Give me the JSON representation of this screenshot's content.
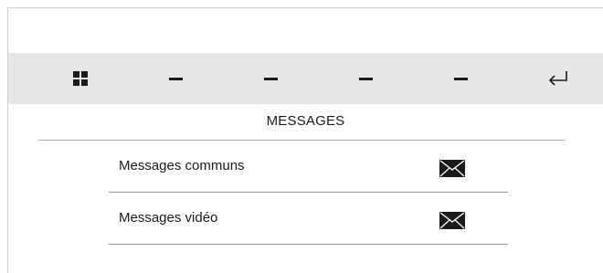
{
  "toolbar": {
    "buttons": [
      {
        "icon": "grid-icon"
      },
      {
        "icon": "dash-icon"
      },
      {
        "icon": "dash-icon"
      },
      {
        "icon": "dash-icon"
      },
      {
        "icon": "dash-icon"
      },
      {
        "icon": "return-arrow-icon"
      }
    ]
  },
  "page": {
    "title": "MESSAGES"
  },
  "messages": {
    "items": [
      {
        "label": "Messages communs",
        "icon": "envelope-icon"
      },
      {
        "label": "Messages vidéo",
        "icon": "envelope-icon"
      }
    ]
  },
  "colors": {
    "toolbar_bg": "#e6e6e6",
    "text": "#1a1a1a",
    "divider": "#9a9a9a"
  }
}
